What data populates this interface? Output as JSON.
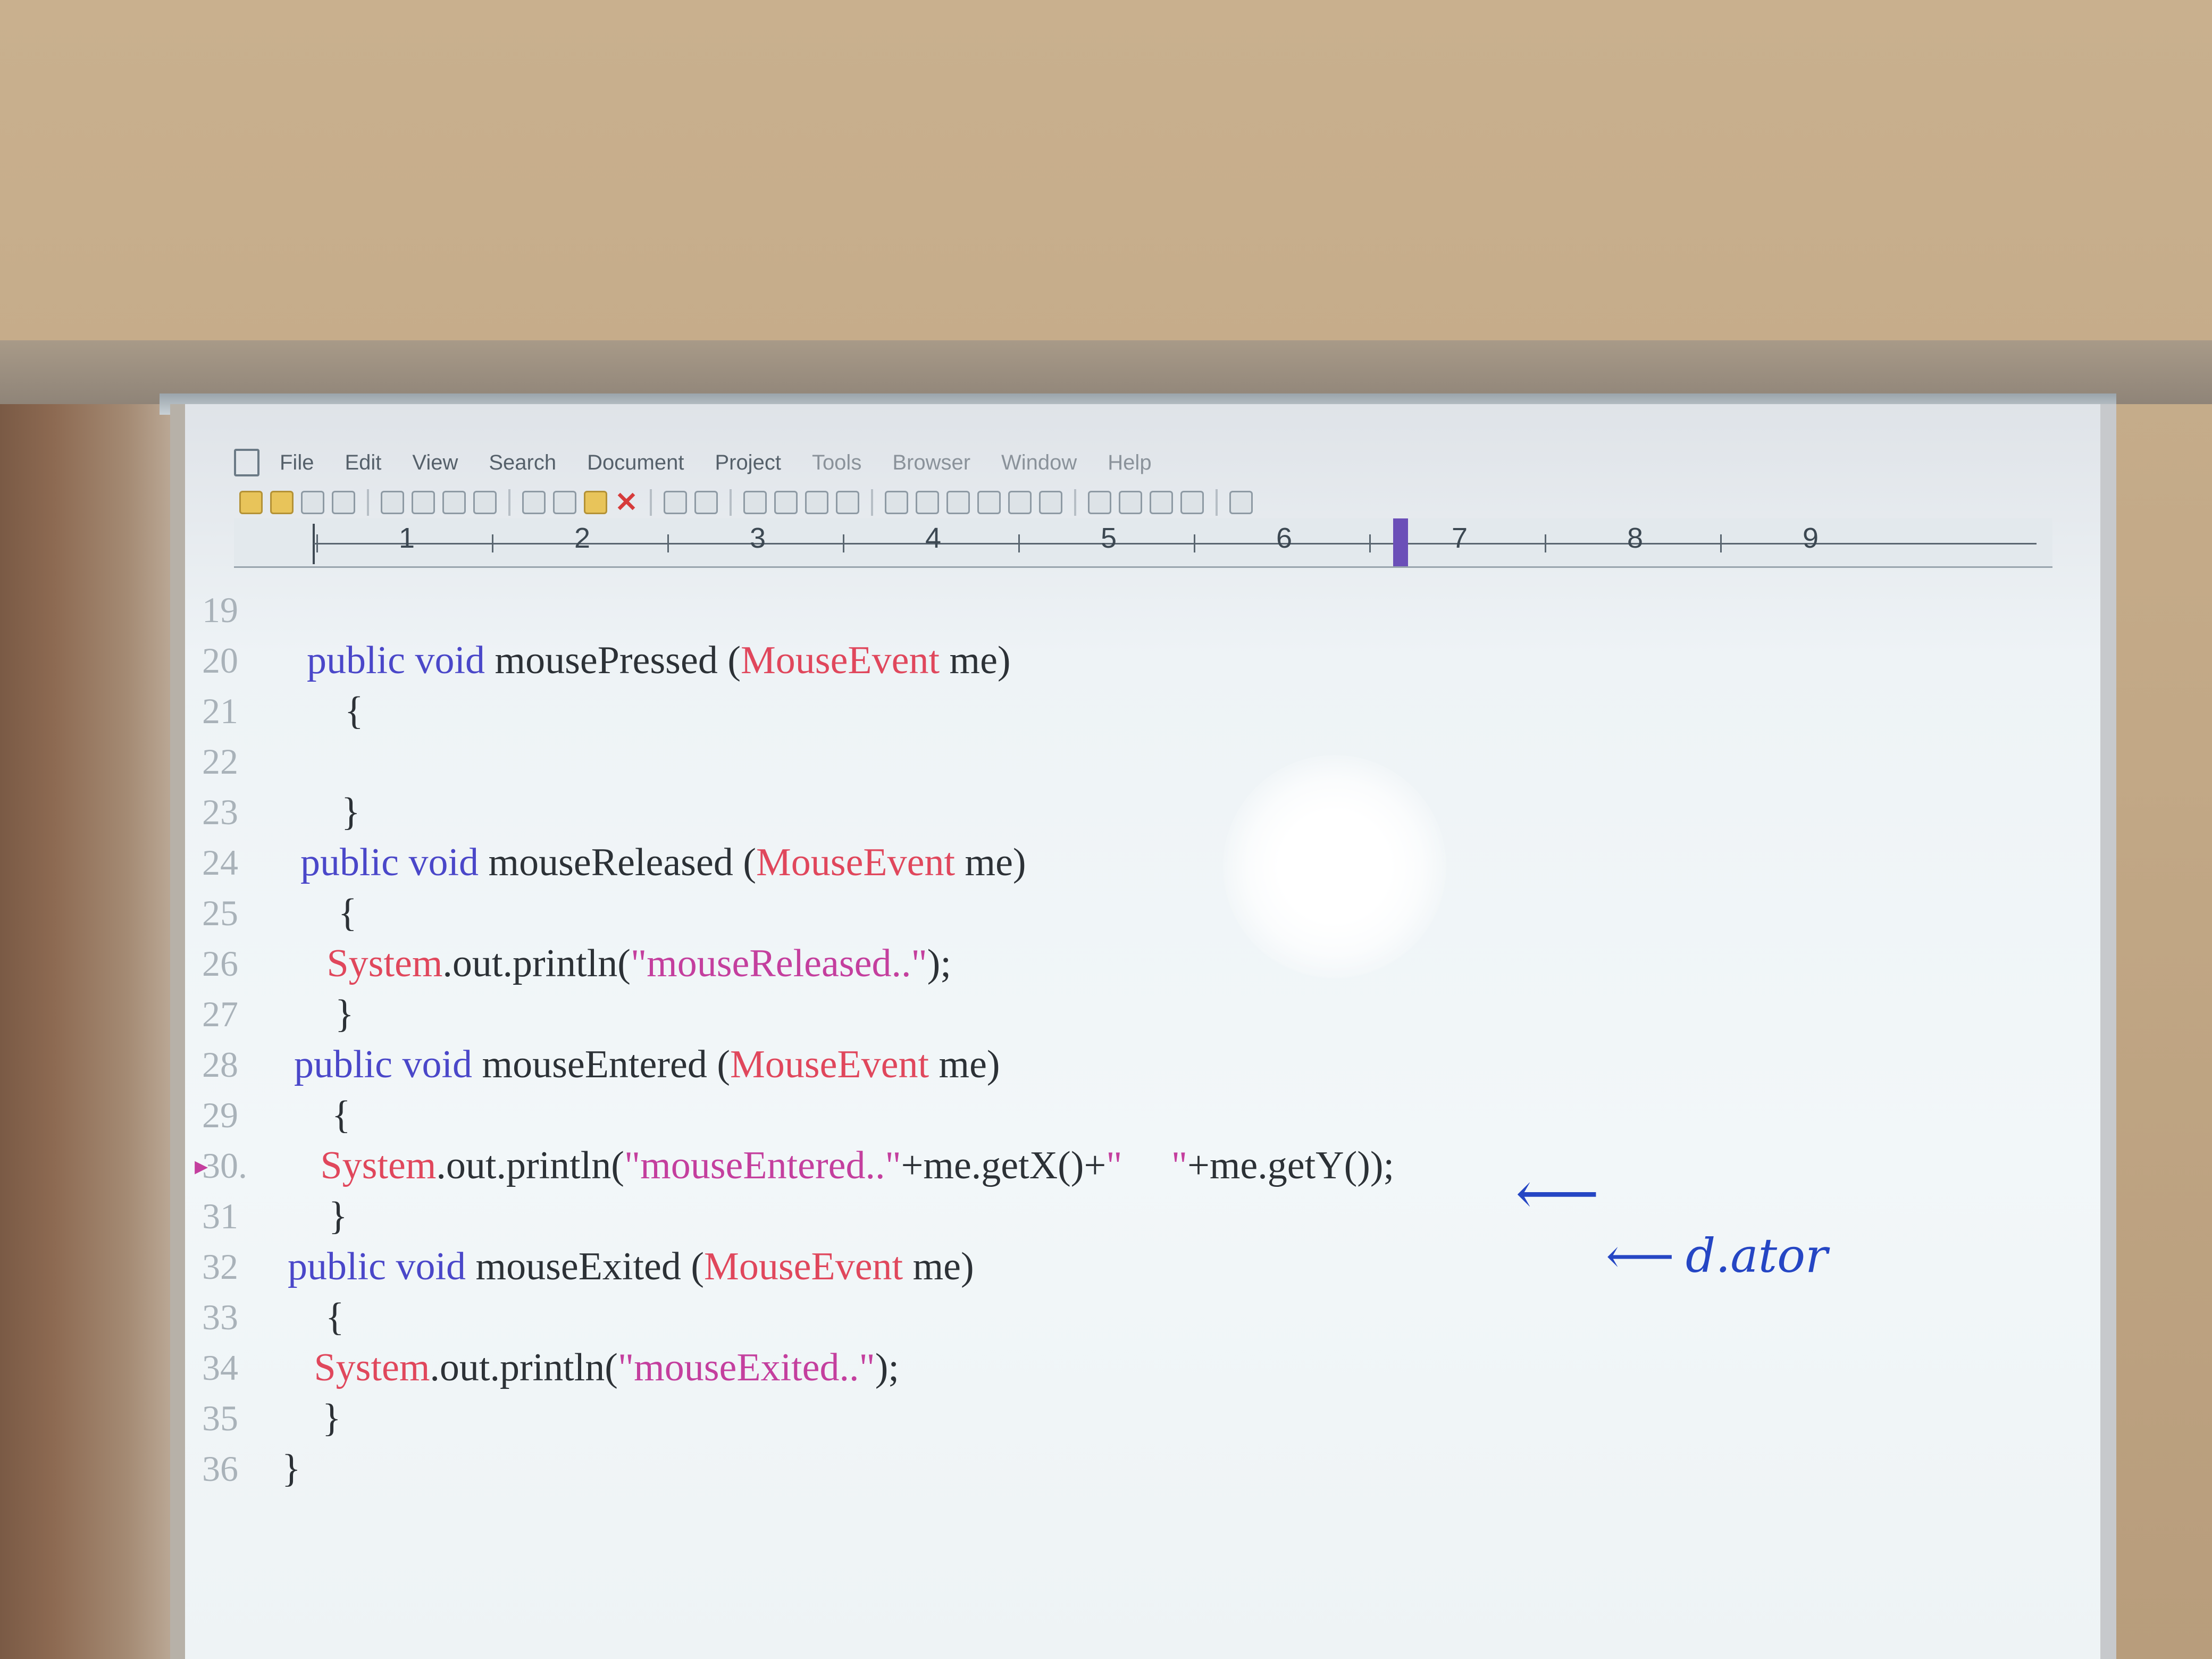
{
  "menubar": {
    "items": [
      "File",
      "Edit",
      "View",
      "Search",
      "Document",
      "Project",
      "Tools",
      "Browser",
      "Window",
      "Help"
    ]
  },
  "ruler": {
    "numbers": [
      "1",
      "2",
      "3",
      "4",
      "5",
      "6",
      "7",
      "8",
      "9"
    ]
  },
  "code_lines": [
    {
      "num": "19",
      "tokens": []
    },
    {
      "num": "20",
      "tokens": [
        {
          "t": "public void",
          "c": "kw"
        },
        {
          "t": " mousePressed ("
        },
        {
          "t": "MouseEvent",
          "c": "cls"
        },
        {
          "t": " me)"
        }
      ],
      "indent": 1
    },
    {
      "num": "21",
      "tokens": [
        {
          "t": "    {"
        }
      ],
      "indent": 1
    },
    {
      "num": "22",
      "tokens": []
    },
    {
      "num": "23",
      "tokens": [
        {
          "t": "    }"
        }
      ],
      "indent": 1
    },
    {
      "num": "24",
      "tokens": [
        {
          "t": "public void",
          "c": "kw"
        },
        {
          "t": " mouseReleased ("
        },
        {
          "t": "MouseEvent",
          "c": "cls"
        },
        {
          "t": " me)"
        }
      ],
      "indent": 1
    },
    {
      "num": "25",
      "tokens": [
        {
          "t": "    {"
        }
      ],
      "indent": 1
    },
    {
      "num": "26",
      "tokens": [
        {
          "t": "   "
        },
        {
          "t": "System",
          "c": "cls"
        },
        {
          "t": ".out.println("
        },
        {
          "t": "\"mouseReleased..\"",
          "c": "str"
        },
        {
          "t": ");"
        }
      ],
      "indent": 1
    },
    {
      "num": "27",
      "tokens": [
        {
          "t": "    }"
        }
      ],
      "indent": 1
    },
    {
      "num": "28",
      "tokens": [
        {
          "t": "public void",
          "c": "kw"
        },
        {
          "t": " mouseEntered ("
        },
        {
          "t": "MouseEvent",
          "c": "cls"
        },
        {
          "t": " me)"
        }
      ],
      "indent": 1
    },
    {
      "num": "29",
      "tokens": [
        {
          "t": "    {"
        }
      ],
      "indent": 1
    },
    {
      "num": "30.",
      "tokens": [
        {
          "t": "   "
        },
        {
          "t": "System",
          "c": "cls"
        },
        {
          "t": ".out.println("
        },
        {
          "t": "\"mouseEntered..\"",
          "c": "str"
        },
        {
          "t": "+me.getX()+"
        },
        {
          "t": "\"     \"",
          "c": "str"
        },
        {
          "t": "+me.getY());"
        }
      ],
      "indent": 1,
      "marker": true
    },
    {
      "num": "31",
      "tokens": [
        {
          "t": "    }"
        }
      ],
      "indent": 1
    },
    {
      "num": "32",
      "tokens": [
        {
          "t": "public void",
          "c": "kw"
        },
        {
          "t": " mouseExited ("
        },
        {
          "t": "MouseEvent",
          "c": "cls"
        },
        {
          "t": " me)"
        }
      ],
      "indent": 1
    },
    {
      "num": "33",
      "tokens": [
        {
          "t": "    {"
        }
      ],
      "indent": 1
    },
    {
      "num": "34",
      "tokens": [
        {
          "t": "   "
        },
        {
          "t": "System",
          "c": "cls"
        },
        {
          "t": ".out.println("
        },
        {
          "t": "\"mouseExited..\"",
          "c": "str"
        },
        {
          "t": ");"
        }
      ],
      "indent": 1
    },
    {
      "num": "35",
      "tokens": [
        {
          "t": "    }"
        }
      ],
      "indent": 1
    },
    {
      "num": "36",
      "tokens": [
        {
          "t": "}"
        }
      ],
      "indent": 0
    }
  ],
  "annotations": {
    "arrow1": "⟵",
    "arrow2": "⟵",
    "note": "d.ator"
  },
  "colors": {
    "keyword": "#4a47c9",
    "class": "#e0475c",
    "string": "#c43f9e",
    "handwriting": "#2546c4"
  }
}
